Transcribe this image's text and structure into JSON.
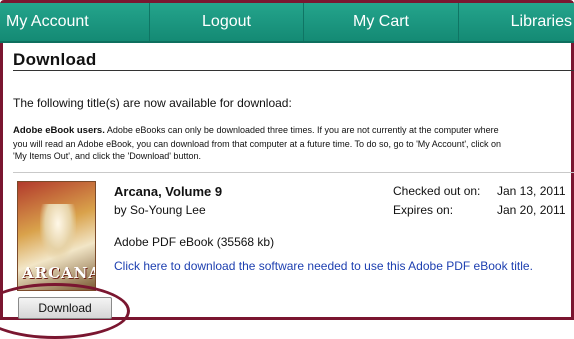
{
  "nav": {
    "items": [
      {
        "label": "My Account"
      },
      {
        "label": "Logout"
      },
      {
        "label": "My Cart"
      },
      {
        "label": "Libraries"
      }
    ]
  },
  "page": {
    "title": "Download",
    "intro": "The following title(s) are now available for download:",
    "note_bold": "Adobe eBook users.",
    "note_line1": " Adobe eBooks can only be downloaded three times. If you are not currently at the computer where",
    "note_line2": "you will read an Adobe eBook, you can download from that computer at a future time. To do so, go to 'My Account', click on",
    "note_line3": "'My Items Out', and click the 'Download' button."
  },
  "item": {
    "cover_logo": "ARCANA",
    "title": "Arcana, Volume 9",
    "author": "by So-Young Lee",
    "format": "Adobe PDF eBook (35568 kb)",
    "software_link": "Click here to download the software needed to use this Adobe PDF eBook title.",
    "checked_out_label": "Checked out on:",
    "checked_out_value": "Jan 13, 2011",
    "expires_label": "Expires on:",
    "expires_value": "Jan 20, 2011",
    "download_button": "Download"
  },
  "colors": {
    "nav_green": "#1b9a82",
    "frame_maroon": "#7a1630",
    "link_blue": "#1d3fb0"
  }
}
